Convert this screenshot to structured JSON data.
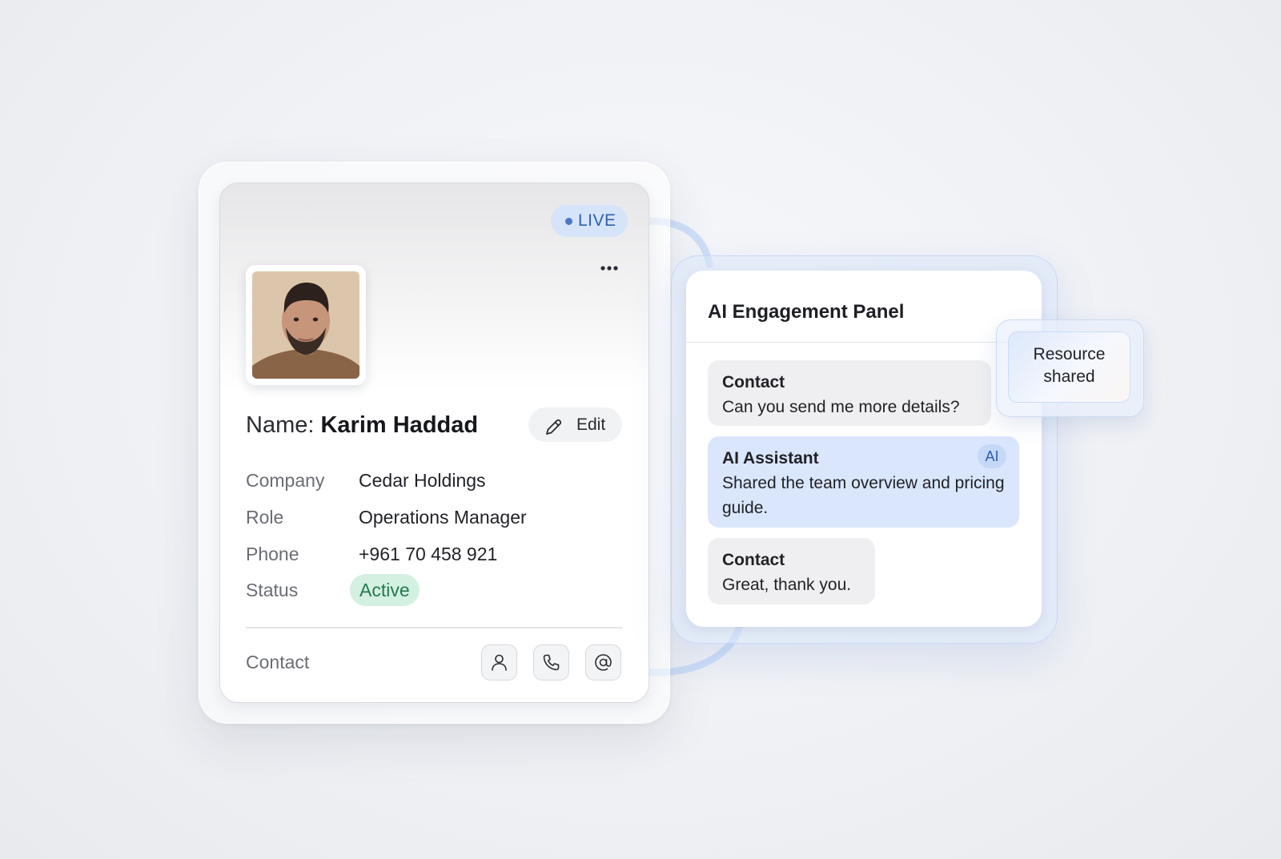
{
  "contact_card": {
    "live_label": "LIVE",
    "name_label": "Name:",
    "name_value": "Karim Haddad",
    "edit_label": "Edit",
    "fields": [
      {
        "label": "Company",
        "value": "Cedar Holdings"
      },
      {
        "label": "Role",
        "value": "Operations Manager"
      },
      {
        "label": "Phone",
        "value": "+961 70 458 921"
      },
      {
        "label": "Status",
        "value": "Active"
      }
    ],
    "contact_label": "Contact",
    "actions": [
      {
        "icon": "person-icon"
      },
      {
        "icon": "phone-icon"
      },
      {
        "icon": "at-sign-icon"
      }
    ]
  },
  "ai_panel": {
    "title": "AI Engagement Panel",
    "messages": [
      {
        "sender": "Contact",
        "text": "Can you send me more details?",
        "kind": "contact"
      },
      {
        "sender": "AI Assistant",
        "text": "Shared the team overview and pricing guide.",
        "kind": "ai",
        "badge": "AI"
      },
      {
        "sender": "Contact",
        "text": "Great, thank you.",
        "kind": "contact"
      }
    ]
  },
  "toast": {
    "line1": "Resource",
    "line2": "shared"
  },
  "colors": {
    "accent_blue": "#4b78c8",
    "live_bg": "#d6e4fa",
    "status_active_bg": "#d4f0e1",
    "status_active_text": "#237a4e",
    "ai_bubble_bg": "#dae6fb",
    "contact_bubble_bg": "#efeff1"
  }
}
